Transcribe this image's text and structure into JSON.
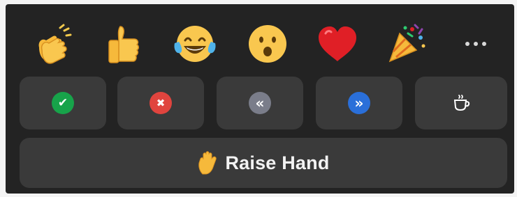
{
  "reactions": [
    {
      "icon": "clapping-hands-icon"
    },
    {
      "icon": "thumbs-up-icon"
    },
    {
      "icon": "tears-of-joy-icon"
    },
    {
      "icon": "open-mouth-icon"
    },
    {
      "icon": "heart-icon"
    },
    {
      "icon": "party-popper-icon"
    }
  ],
  "more": {
    "icon": "more-options-icon"
  },
  "feedback": [
    {
      "icon": "checkmark-icon",
      "glyph": "✔",
      "color": "#17a34a"
    },
    {
      "icon": "x-icon",
      "glyph": "✖",
      "color": "#e0443e"
    },
    {
      "icon": "slow-down-icon",
      "glyph": "«",
      "color": "#7a7d8a"
    },
    {
      "icon": "speed-up-icon",
      "glyph": "»",
      "color": "#2a6fd9"
    },
    {
      "icon": "coffee-cup-icon",
      "glyph": "",
      "color": "#3a3a3a"
    }
  ],
  "raise_hand": {
    "icon": "raised-hand-icon",
    "label": "Raise Hand"
  },
  "colors": {
    "panel_background": "#232323",
    "button_background": "#3a3a3a",
    "text": "#f2f2f2"
  }
}
